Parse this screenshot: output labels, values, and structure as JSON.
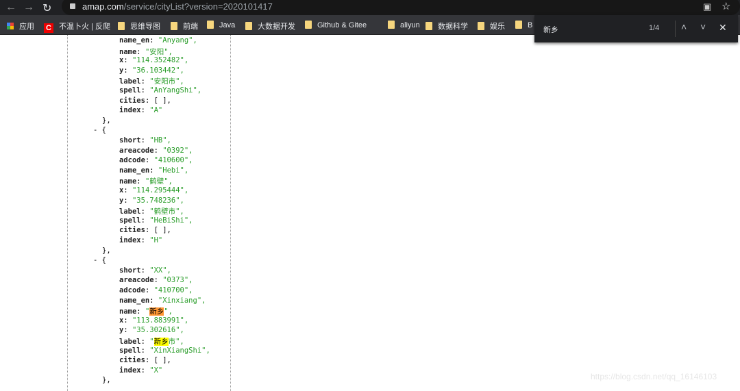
{
  "browser": {
    "url_host": "amap.com",
    "url_path": "/service/cityList?version=2020101417"
  },
  "bookmarks": [
    {
      "label": "应用",
      "icon": "apps-grid-icon"
    },
    {
      "label": "不温卜火 | 反爬",
      "icon": "csdn-icon"
    },
    {
      "label": "思维导图",
      "icon": "folder-icon"
    },
    {
      "label": "前端",
      "icon": "folder-icon"
    },
    {
      "label": "Java",
      "icon": "folder-icon"
    },
    {
      "label": "大数据开发",
      "icon": "folder-icon"
    },
    {
      "label": "Github & Gitee",
      "icon": "folder-icon"
    },
    {
      "label": "aliyun",
      "icon": "folder-icon"
    },
    {
      "label": "数据科学",
      "icon": "folder-icon"
    },
    {
      "label": "娱乐",
      "icon": "folder-icon"
    },
    {
      "label": "B",
      "icon": "folder-icon"
    }
  ],
  "find": {
    "query": "新乡",
    "count": "1/4"
  },
  "lines": [
    {
      "i": 2,
      "k": "name_en",
      "v": "\"Anyang\","
    },
    {
      "i": 2,
      "k": "name",
      "v": "\"安阳\","
    },
    {
      "i": 2,
      "k": "x",
      "v": "\"114.352482\","
    },
    {
      "i": 2,
      "k": "y",
      "v": "\"36.103442\","
    },
    {
      "i": 2,
      "k": "label",
      "v": "\"安阳市\","
    },
    {
      "i": 2,
      "k": "spell",
      "v": "\"AnYangShi\","
    },
    {
      "i": 2,
      "k": "cities",
      "p": "[ ],"
    },
    {
      "i": 2,
      "k": "index",
      "v": "\"A\""
    },
    {
      "i": 1,
      "p": "},"
    },
    {
      "i": 0,
      "p": "- {"
    },
    {
      "i": 2,
      "k": "short",
      "v": "\"HB\","
    },
    {
      "i": 2,
      "k": "areacode",
      "v": "\"0392\","
    },
    {
      "i": 2,
      "k": "adcode",
      "v": "\"410600\","
    },
    {
      "i": 2,
      "k": "name_en",
      "v": "\"Hebi\","
    },
    {
      "i": 2,
      "k": "name",
      "v": "\"鹤壁\","
    },
    {
      "i": 2,
      "k": "x",
      "v": "\"114.295444\","
    },
    {
      "i": 2,
      "k": "y",
      "v": "\"35.748236\","
    },
    {
      "i": 2,
      "k": "label",
      "v": "\"鹤壁市\","
    },
    {
      "i": 2,
      "k": "spell",
      "v": "\"HeBiShi\","
    },
    {
      "i": 2,
      "k": "cities",
      "p": "[ ],"
    },
    {
      "i": 2,
      "k": "index",
      "v": "\"H\""
    },
    {
      "i": 1,
      "p": "},"
    },
    {
      "i": 0,
      "p": "- {"
    },
    {
      "i": 2,
      "k": "short",
      "v": "\"XX\","
    },
    {
      "i": 2,
      "k": "areacode",
      "v": "\"0373\","
    },
    {
      "i": 2,
      "k": "adcode",
      "v": "\"410700\","
    },
    {
      "i": 2,
      "k": "name_en",
      "v": "\"Xinxiang\","
    },
    {
      "i": 2,
      "k": "name",
      "pre": "\"",
      "hlc": "新乡",
      "post": "\","
    },
    {
      "i": 2,
      "k": "x",
      "v": "\"113.883991\","
    },
    {
      "i": 2,
      "k": "y",
      "v": "\"35.302616\","
    },
    {
      "i": 2,
      "k": "label",
      "pre": "\"",
      "hl": "新乡",
      "post": "市\","
    },
    {
      "i": 2,
      "k": "spell",
      "v": "\"XinXiangShi\","
    },
    {
      "i": 2,
      "k": "cities",
      "p": "[ ],"
    },
    {
      "i": 2,
      "k": "index",
      "v": "\"X\""
    },
    {
      "i": 1,
      "p": "},"
    }
  ],
  "watermark": "https://blog.csdn.net/qq_16146103"
}
